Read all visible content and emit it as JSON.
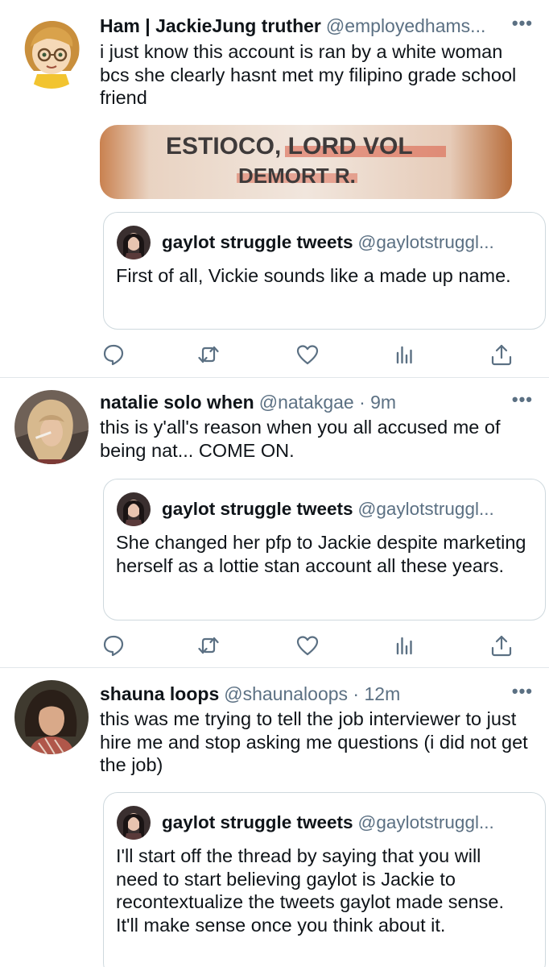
{
  "tweets": [
    {
      "name": "Ham | JackieJung truther",
      "handle": "@employedhams...",
      "more": "•••",
      "text": "i just know this account is ran by a white woman bcs she clearly hasnt met my filipino grade school friend",
      "media": {
        "line1": "ESTIOCO, LORD VOL",
        "line2": "DEMORT R."
      },
      "quote": {
        "name": "gaylot struggle tweets",
        "handle": "@gaylotstruggl...",
        "text": "First of all, Vickie sounds like a made up name."
      }
    },
    {
      "name": "natalie solo when",
      "handle": "@natakgae · 9m",
      "more": "•••",
      "text": "this is y'all's reason when you all accused me of being nat... COME ON.",
      "quote": {
        "name": "gaylot struggle tweets",
        "handle": "@gaylotstruggl...",
        "text": "She changed her pfp to Jackie despite marketing herself as a lottie stan account all these years."
      }
    },
    {
      "name": "shauna loops",
      "handle": "@shaunaloops · 12m",
      "more": "•••",
      "text": "this was me trying to tell the job interviewer to just hire me and stop asking me questions (i did not get the job)",
      "quote": {
        "name": "gaylot struggle tweets",
        "handle": "@gaylotstruggl...",
        "text": "I'll start off the thread by saying that you will need to start believing gaylot is Jackie to recontextualize the tweets gaylot made sense. It'll make sense once you think about it."
      }
    }
  ],
  "icons": [
    "reply-icon",
    "retweet-icon",
    "like-icon",
    "analytics-icon",
    "share-icon"
  ],
  "colors": {
    "text": "#0f1419",
    "secondary": "#5b7083",
    "border": "#cfd9de",
    "divider": "#e1e6ea"
  }
}
